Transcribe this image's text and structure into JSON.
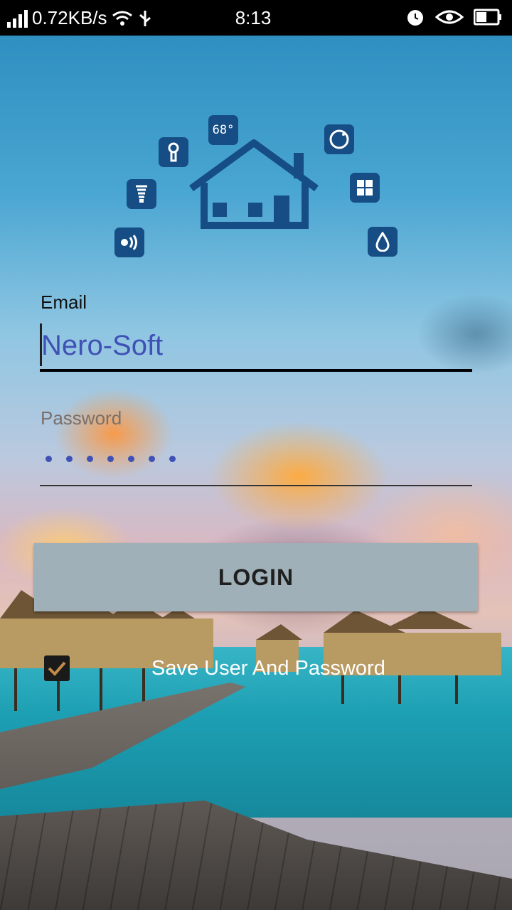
{
  "status_bar": {
    "network_speed": "0.72KB/s",
    "time": "8:13",
    "icons": [
      "signal-icon",
      "wifi-icon",
      "usb-icon",
      "alarm-icon",
      "eye-icon",
      "battery-icon"
    ]
  },
  "logo": {
    "house_icon": "house-icon",
    "tiles": [
      "speaker-icon",
      "bulb-icon",
      "keyhole-icon",
      "thermostat-icon",
      "camera-icon",
      "grid-icon",
      "water-drop-icon"
    ],
    "thermostat_text": "68°",
    "color": "#154d84"
  },
  "form": {
    "email_label": "Email",
    "email_value": "Nero-Soft",
    "password_label": "Password",
    "password_mask_length": 7,
    "login_button": "LOGIN",
    "save_checkbox_checked": true,
    "save_label": "Save User And Password"
  },
  "colors": {
    "input_text": "#3f51b5",
    "button_bg": "#9fb0b8",
    "icon_blue": "#154d84"
  }
}
